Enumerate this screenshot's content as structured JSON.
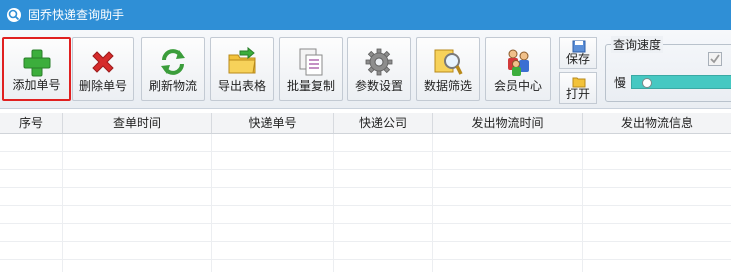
{
  "window": {
    "title": "固乔快递查询助手",
    "icon": "magnifier-app-icon"
  },
  "toolbar": {
    "buttons": [
      {
        "label": "添加单号",
        "icon": "green-plus-icon",
        "selected": true
      },
      {
        "label": "删除单号",
        "icon": "red-x-icon"
      },
      {
        "label": "刷新物流",
        "icon": "refresh-icon"
      },
      {
        "label": "导出表格",
        "icon": "folder-export-icon"
      },
      {
        "label": "批量复制",
        "icon": "copy-icon"
      },
      {
        "label": "参数设置",
        "icon": "gear-icon"
      },
      {
        "label": "数据筛选",
        "icon": "search-filter-icon"
      },
      {
        "label": "会员中心",
        "icon": "users-icon"
      }
    ],
    "save_label": "保存",
    "open_label": "打开"
  },
  "speed": {
    "title": "查询速度",
    "slow_label": "慢",
    "checkbox_checked": true,
    "slider_level": 0.08
  },
  "table": {
    "columns": [
      "序号",
      "查单时间",
      "快递单号",
      "快递公司",
      "发出物流时间",
      "发出物流信息"
    ],
    "rows": []
  },
  "colors": {
    "titlebar": "#2f8fd6",
    "selected_border": "#e02020",
    "slider": "#46c8c2"
  }
}
